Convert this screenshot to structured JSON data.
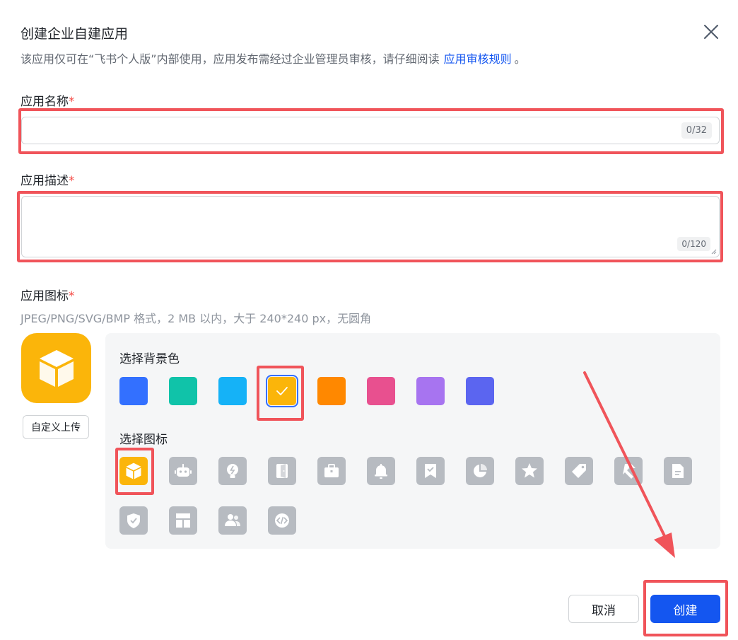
{
  "dialog": {
    "title": "创建企业自建应用",
    "subtitle_text": "该应用仅可在“飞书个人版”内部使用，应用发布需经过企业管理员审核，请仔细阅读",
    "subtitle_link": "应用审核规则",
    "subtitle_tail": "。"
  },
  "name_field": {
    "label": "应用名称",
    "required_mark": "*",
    "value": "",
    "counter": "0/32"
  },
  "desc_field": {
    "label": "应用描述",
    "required_mark": "*",
    "value": "",
    "counter": "0/120"
  },
  "icon_field": {
    "label": "应用图标",
    "required_mark": "*",
    "hint": "JPEG/PNG/SVG/BMP 格式，2 MB 以内，大于 240*240 px，无圆角",
    "upload_label": "自定义上传",
    "preview_icon": "cube-icon",
    "bg_section_label": "选择背景色",
    "icon_section_label": "选择图标",
    "background_colors": [
      "#3370ff",
      "#10c3a9",
      "#15b2f7",
      "#fbb50a",
      "#ff8800",
      "#e8508f",
      "#a774f0",
      "#5b65f0"
    ],
    "selected_background": "#fbb50a",
    "icons": [
      "cube-icon",
      "robot-icon",
      "bulb-icon",
      "door-icon",
      "briefcase-icon",
      "bell-icon",
      "bookmark-check-icon",
      "pie-chart-icon",
      "star-badge-icon",
      "tag-icon",
      "tool-icon",
      "document-icon",
      "shield-check-icon",
      "layout-icon",
      "users-icon",
      "code-icon"
    ],
    "selected_icon": "cube-icon"
  },
  "footer": {
    "cancel_label": "取消",
    "create_label": "创建"
  },
  "colors": {
    "primary": "#1456f0",
    "annotation_red": "#f0545a",
    "required_red": "#f54a45"
  }
}
